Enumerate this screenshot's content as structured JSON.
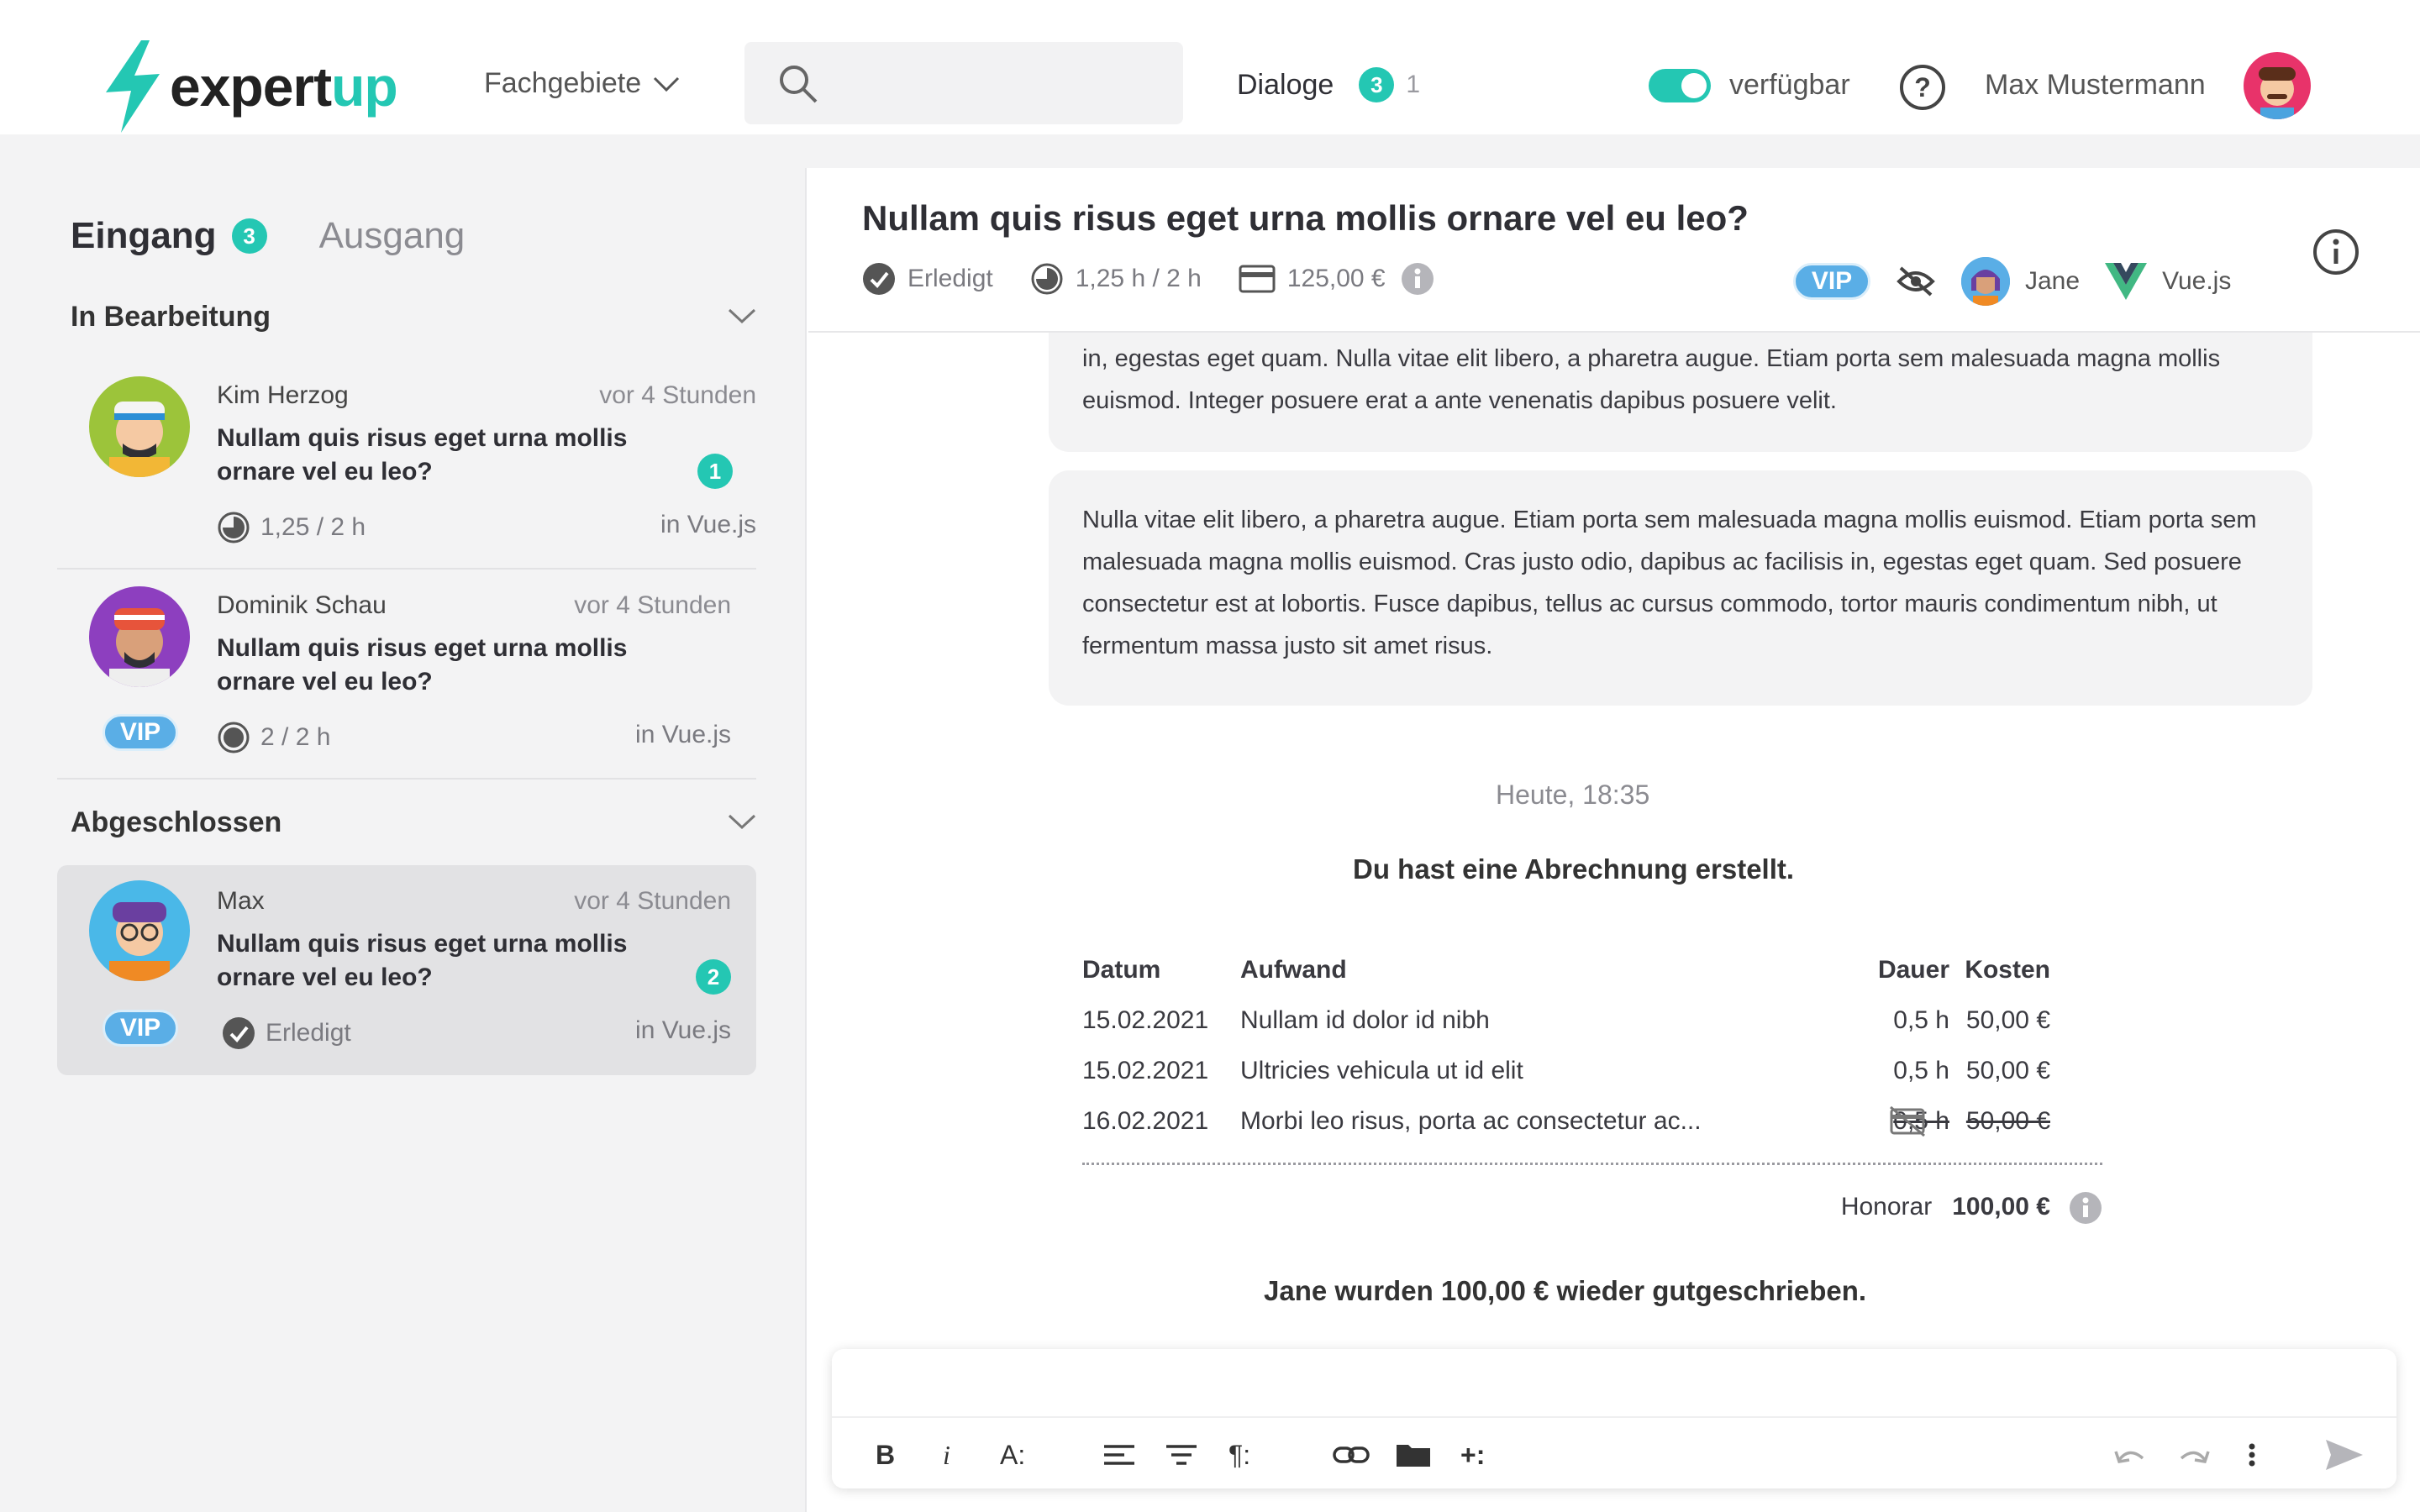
{
  "header": {
    "logo_part1": "expert",
    "logo_part2": "up",
    "nav_fachgebiete": "Fachgebiete",
    "search_placeholder": "",
    "dialoge_label": "Dialoge",
    "dialoge_badge": "3",
    "dialoge_secondary": "1",
    "availability_label": "verfügbar",
    "user_name": "Max Mustermann",
    "accent_color": "#24c7b3"
  },
  "sidebar": {
    "tab_inbox": "Eingang",
    "tab_inbox_badge": "3",
    "tab_outbox": "Ausgang",
    "section_active": "In Bearbeitung",
    "section_closed": "Abgeschlossen",
    "items": [
      {
        "name": "Kim Herzog",
        "time": "vor 4 Stunden",
        "question": "Nullam quis risus eget urna mollis ornare vel eu leo?",
        "badge": "1",
        "progress": "1,25 / 2 h",
        "category": "in Vue.js"
      },
      {
        "name": "Dominik Schau",
        "time": "vor 4 Stunden",
        "question": "Nullam quis risus eget urna mollis ornare vel eu leo?",
        "vip": "VIP",
        "progress": "2 / 2 h",
        "category": "in Vue.js"
      },
      {
        "name": "Max",
        "time": "vor 4 Stunden",
        "question": "Nullam quis risus eget urna mollis ornare vel eu leo?",
        "badge": "2",
        "vip": "VIP",
        "status": "Erledigt",
        "category": "in Vue.js"
      }
    ]
  },
  "main": {
    "title": "Nullam quis risus eget urna mollis ornare vel eu leo?",
    "status": "Erledigt",
    "time_progress": "1,25 h / 2 h",
    "amount": "125,00 €",
    "vip": "VIP",
    "expert_name": "Jane",
    "topic": "Vue.js",
    "messages": [
      "in, egestas eget quam. Nulla vitae elit libero, a pharetra augue. Etiam porta sem malesuada magna mollis euismod. Integer posuere erat a ante venenatis dapibus posuere velit.",
      "Nulla vitae elit libero, a pharetra augue. Etiam porta sem malesuada magna mollis euismod. Etiam porta sem malesuada magna mollis euismod. Cras justo odio, dapibus ac facilisis in, egestas eget quam. Sed posuere consectetur est at lobortis. Fusce dapibus, tellus ac cursus commodo, tortor mauris condimentum nibh, ut fermentum massa justo sit amet risus."
    ],
    "timestamp": "Heute, 18:35",
    "invoice_created": "Du hast eine Abrechnung erstellt.",
    "invoice": {
      "headers": {
        "date": "Datum",
        "desc": "Aufwand",
        "duration": "Dauer",
        "cost": "Kosten"
      },
      "rows": [
        {
          "date": "15.02.2021",
          "desc": "Nullam id dolor id nibh",
          "duration": "0,5 h",
          "cost": "50,00 €"
        },
        {
          "date": "15.02.2021",
          "desc": "Ultricies vehicula ut id elit",
          "duration": "0,5 h",
          "cost": "50,00 €"
        },
        {
          "date": "16.02.2021",
          "desc": "Morbi leo risus, porta ac consectetur ac...",
          "duration": "0,5 h",
          "cost": "50,00 €"
        }
      ],
      "fee_label": "Honorar",
      "fee_value": "100,00 €"
    },
    "credited": "Jane wurden 100,00 € wieder gutgeschrieben."
  },
  "composer": {
    "bold": "B",
    "italic": "i",
    "font_size": "A:",
    "paragraph": "¶:",
    "insert": "+:"
  }
}
